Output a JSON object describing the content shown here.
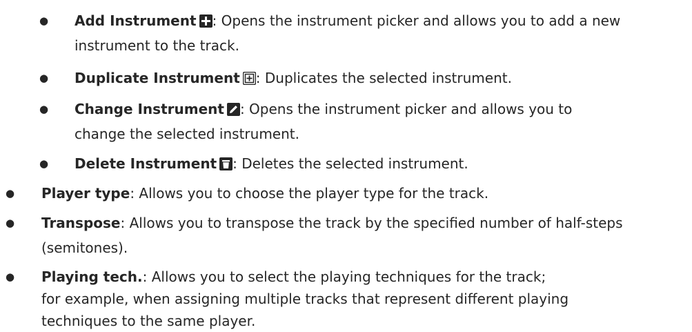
{
  "sub_items": [
    {
      "term": "Add Instrument",
      "icon": "plus-icon",
      "desc": ": Opens the instrument picker and allows you to add a new instrument to the track.",
      "line1": ": Opens the instrument picker and allows you to add a new",
      "line2": "instrument to the track."
    },
    {
      "term": "Duplicate Instrument",
      "icon": "duplicate-icon",
      "line1": ": Duplicates the selected instrument."
    },
    {
      "term": "Change Instrument",
      "icon": "pencil-icon",
      "line1": ": Opens the instrument picker and allows you to",
      "line2": "change the selected instrument."
    },
    {
      "term": "Delete Instrument",
      "icon": "trash-icon",
      "line1": ": Deletes the selected instrument."
    }
  ],
  "top_items": [
    {
      "term": "Player type",
      "line1": ": Allows you to choose the player type for the track."
    },
    {
      "term": "Transpose",
      "line1": ": Allows you to transpose the track by the specified number of half-steps",
      "line2": "(semitones)."
    },
    {
      "term": "Playing tech.",
      "line1": ": Allows you to select the playing techniques for the track;",
      "line2": "for example, when assigning multiple tracks that represent different playing",
      "line3": "techniques to the same player."
    }
  ],
  "bullet_char": "●",
  "colors": {
    "text": "#262626",
    "icon_bg": "#262626",
    "icon_fg": "#ffffff"
  }
}
